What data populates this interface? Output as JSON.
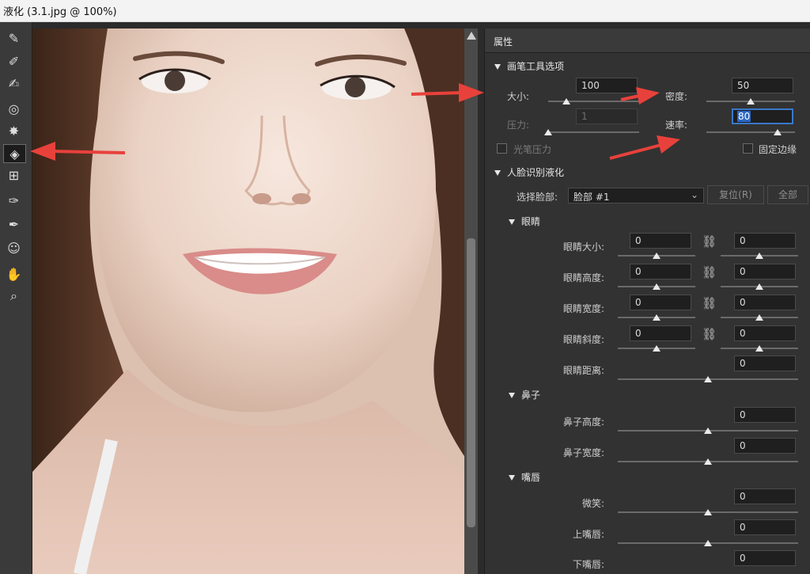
{
  "window": {
    "title": "液化 (3.1.jpg @ 100%)"
  },
  "toolbar": {
    "tools": [
      {
        "icon": "forward-warp-icon",
        "glyph": "✎"
      },
      {
        "icon": "reconstruct-icon",
        "glyph": "✐"
      },
      {
        "icon": "smooth-icon",
        "glyph": "✍"
      },
      {
        "icon": "twirl-icon",
        "glyph": "◎"
      },
      {
        "icon": "pucker-icon",
        "glyph": "✸"
      },
      {
        "icon": "face-tool-icon",
        "glyph": "◈"
      },
      {
        "icon": "push-left-icon",
        "glyph": "⊞"
      },
      {
        "icon": "freeze-mask-icon",
        "glyph": "✑"
      },
      {
        "icon": "thaw-mask-icon",
        "glyph": "✒"
      },
      {
        "icon": "face-select-icon",
        "glyph": "☺"
      },
      {
        "icon": "hand-icon",
        "glyph": "✋"
      },
      {
        "icon": "zoom-icon",
        "glyph": "⌕"
      }
    ],
    "active_index": 5
  },
  "panel": {
    "header": "属性",
    "brush": {
      "title": "画笔工具选项",
      "size_label": "大小:",
      "size_value": "100",
      "size_level": 0.2,
      "density_label": "密度:",
      "density_value": "50",
      "density_level": 0.5,
      "pressure_label": "压力:",
      "pressure_value": "1",
      "pressure_level": 0.0,
      "rate_label": "速率:",
      "rate_value": "80",
      "rate_level": 0.8,
      "stylus_label": "光笔压力",
      "stylus_checked": false,
      "pin_label": "固定边缘",
      "pin_checked": false
    },
    "face": {
      "title": "人脸识别液化",
      "select_label": "选择脸部:",
      "select_value": "脸部 #1",
      "reset_label": "复位(R)",
      "all_label": "全部"
    },
    "eyes": {
      "title": "眼睛",
      "rows": [
        {
          "label": "眼睛大小:",
          "left": "0",
          "right": "0"
        },
        {
          "label": "眼睛高度:",
          "left": "0",
          "right": "0"
        },
        {
          "label": "眼睛宽度:",
          "left": "0",
          "right": "0"
        },
        {
          "label": "眼睛斜度:",
          "left": "0",
          "right": "0"
        }
      ],
      "distance_label": "眼睛距离:",
      "distance_value": "0"
    },
    "nose": {
      "title": "鼻子",
      "rows": [
        {
          "label": "鼻子高度:",
          "value": "0"
        },
        {
          "label": "鼻子宽度:",
          "value": "0"
        }
      ]
    },
    "mouth": {
      "title": "嘴唇",
      "rows": [
        {
          "label": "微笑:",
          "value": "0"
        },
        {
          "label": "上嘴唇:",
          "value": "0"
        },
        {
          "label": "下嘴唇:",
          "value": "0"
        }
      ]
    }
  },
  "annotation_color": "#e8413b"
}
